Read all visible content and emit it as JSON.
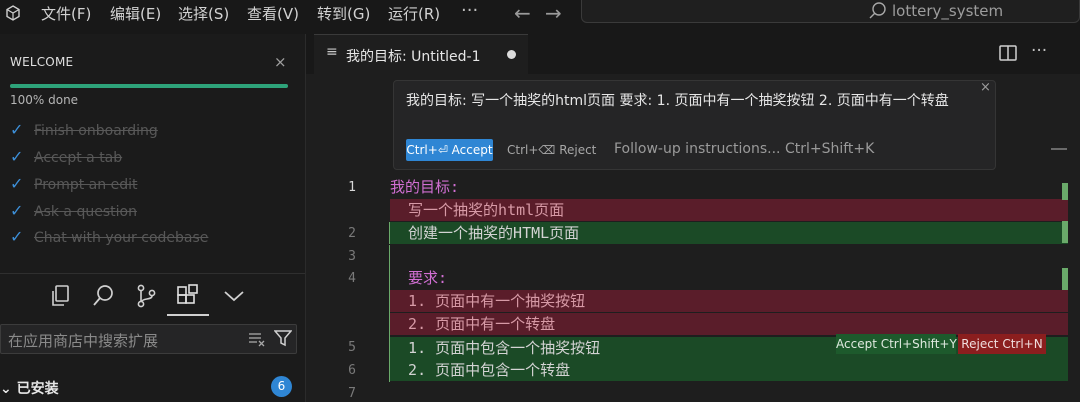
{
  "titlebar": {
    "menu": [
      "文件(F)",
      "编辑(E)",
      "选择(S)",
      "查看(V)",
      "转到(G)",
      "运行(R)"
    ],
    "more": "···",
    "back": "←",
    "forward": "→",
    "search_text": "lottery_system"
  },
  "welcome": {
    "title": "WELCOME",
    "close": "×",
    "progress_text": "100% done",
    "progress_fraction": 1.0,
    "items": [
      "Finish onboarding",
      "Accept a tab",
      "Prompt an edit",
      "Ask a question",
      "Chat with your codebase"
    ]
  },
  "extensions": {
    "search_placeholder": "在应用商店中搜索扩展",
    "installed_label": "已安装",
    "installed_count": "6"
  },
  "tab": {
    "icon": "≡",
    "label": "我的目标:  Untitled-1"
  },
  "prompt": {
    "text": "我的目标:   写一个抽奖的html页面  要求:   1. 页面中有一个抽奖按钮  2. 页面中有一个转盘",
    "close": "×",
    "accept": "Ctrl+⏎ Accept",
    "reject": "Ctrl+⌫ Reject",
    "followup": "Follow-up instructions... Ctrl+Shift+K"
  },
  "code": {
    "line_numbers": [
      "1",
      "2",
      "3",
      "4",
      "5",
      "6",
      "7"
    ],
    "line1": "我的目标:",
    "del1": "  写一个抽奖的html页面",
    "add1": "  创建一个抽奖的HTML页面",
    "line4": "  要求:",
    "del2": "  1. 页面中有一个抽奖按钮",
    "del3": "  2. 页面中有一个转盘",
    "add2": "  1. 页面中包含一个抽奖按钮",
    "add3": "  2. 页面中包含一个转盘",
    "accept_hint": "Accept Ctrl+Shift+Y",
    "reject_hint": "Reject Ctrl+N"
  },
  "colors": {
    "accent": "#2f86d4",
    "progress": "#2ea37a",
    "diff_delete": "#5a1d2a",
    "diff_add": "#1b4a26"
  }
}
